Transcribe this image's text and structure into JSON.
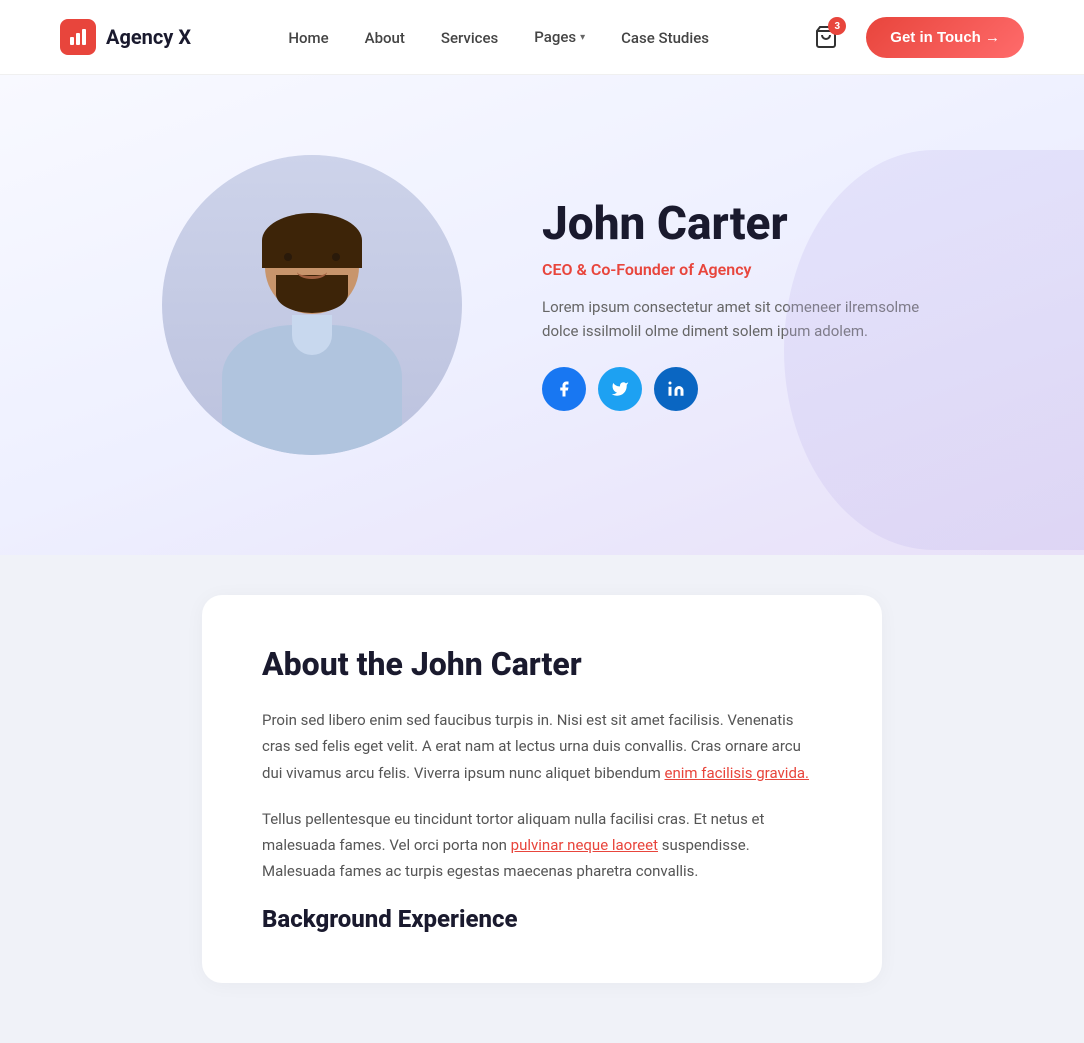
{
  "brand": {
    "name": "Agency X"
  },
  "navbar": {
    "links": [
      {
        "label": "Home",
        "hasDropdown": false
      },
      {
        "label": "About",
        "hasDropdown": false
      },
      {
        "label": "Services",
        "hasDropdown": false
      },
      {
        "label": "Pages",
        "hasDropdown": true
      },
      {
        "label": "Case Studies",
        "hasDropdown": false
      }
    ],
    "cart_badge": "3",
    "cta_label": "Get in Touch →"
  },
  "hero": {
    "name": "John Carter",
    "title": "CEO & Co-Founder of Agency",
    "bio": "Lorem ipsum consectetur amet sit comeneer ilremsolme dolce issilmolil olme diment solem ipum adolem."
  },
  "social": {
    "facebook": "f",
    "twitter": "t",
    "linkedin": "in"
  },
  "about": {
    "heading": "About the John Carter",
    "para1": "Proin sed libero enim sed faucibus turpis in. Nisi est sit amet facilisis. Venenatis cras sed felis eget velit. A erat nam at lectus urna duis convallis. Cras ornare arcu dui vivamus arcu felis. Viverra ipsum nunc aliquet bibendum",
    "para1_link": "enim facilisis gravida.",
    "para2_prefix": "Tellus pellentesque eu tincidunt tortor aliquam nulla facilisi cras. Et netus et malesuada fames. Vel orci porta non",
    "para2_link": "pulvinar neque laoreet",
    "para2_suffix": "suspendisse. Malesuada fames ac turpis egestas maecenas pharetra convallis.",
    "background_heading": "Background Experience"
  }
}
